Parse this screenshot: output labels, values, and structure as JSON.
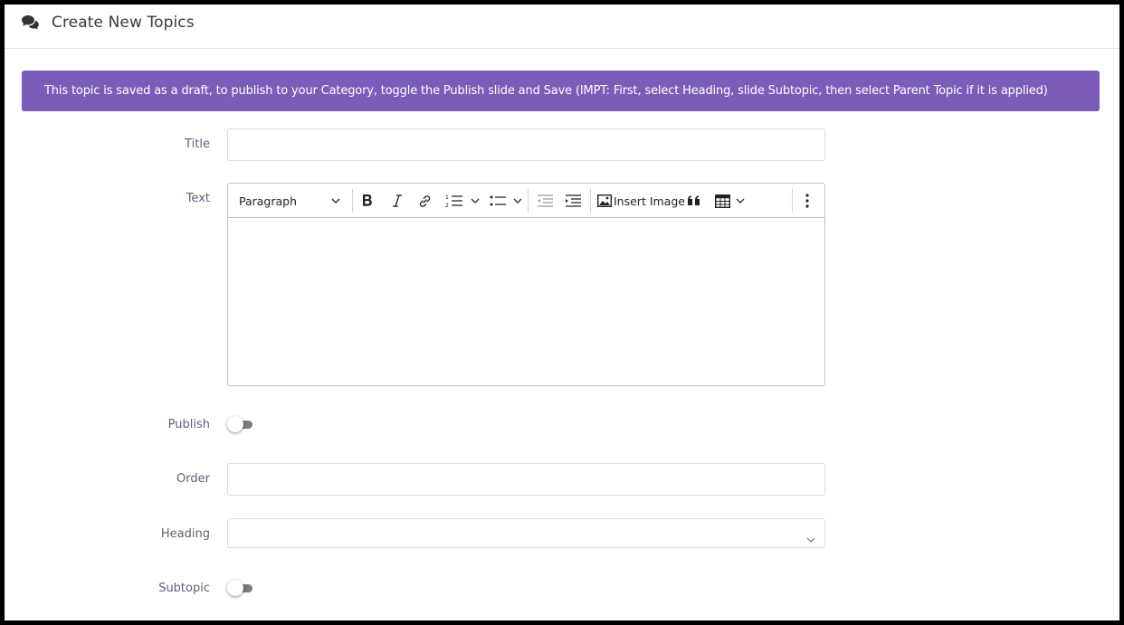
{
  "header": {
    "icon": "comments-icon",
    "title": "Create New Topics"
  },
  "alert": {
    "text": "This topic is saved as a draft, to publish to your Category, toggle the Publish slide and Save (IMPT: First, select Heading, slide Subtopic, then select Parent Topic if it is applied)",
    "color": "#7b5cb9"
  },
  "form": {
    "title_label": "Title",
    "title_value": "",
    "text_label": "Text",
    "publish_label": "Publish",
    "publish_on": false,
    "order_label": "Order",
    "order_value": "",
    "heading_label": "Heading",
    "heading_value": "",
    "subtopic_label": "Subtopic",
    "subtopic_on": false
  },
  "editor": {
    "paragraph_label": "Paragraph",
    "insert_image_label": "Insert Image",
    "content": "",
    "icons": [
      "bold-icon",
      "italic-icon",
      "link-icon",
      "numbered-list-icon",
      "bulleted-list-icon",
      "outdent-icon",
      "indent-icon",
      "image-icon",
      "blockquote-icon",
      "table-icon",
      "more-options-icon"
    ]
  }
}
